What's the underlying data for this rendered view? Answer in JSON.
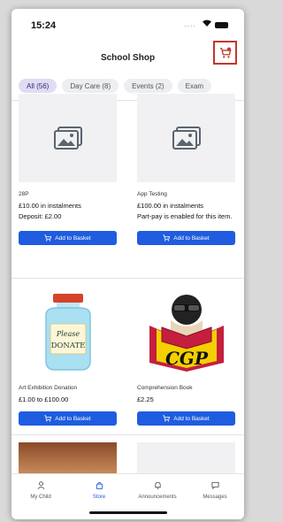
{
  "status_bar": {
    "time": "15:24",
    "dots": "...."
  },
  "header": {
    "title": "School Shop",
    "cart_icon": "shopping-cart-icon",
    "accent": "#c0392b"
  },
  "filters": [
    {
      "label": "All (56)",
      "active": true
    },
    {
      "label": "Day Care (8)",
      "active": false
    },
    {
      "label": "Events (2)",
      "active": false
    },
    {
      "label": "Exam",
      "active": false
    }
  ],
  "products": [
    {
      "name": "28P",
      "price": "£10.00 in instalments",
      "extra": "Deposit: £2.00",
      "image": "image-placeholder-icon"
    },
    {
      "name": "App Testing",
      "price": "£100.00 in instalments",
      "extra": "Part-pay is enabled for this item.",
      "image": "image-placeholder-icon"
    },
    {
      "name": "Art Exhibition Donation",
      "price": "£1.00 to £100.00",
      "extra": "",
      "image": "donation-jar-image",
      "image_text": "Please\nDONATE"
    },
    {
      "name": "Comprehension Book",
      "price": "£2.25",
      "extra": "",
      "image": "cgp-book-image",
      "image_text": "CGP"
    }
  ],
  "add_to_basket_label": "Add to Basket",
  "button_color": "#1f5ce0",
  "tabs": [
    {
      "label": "My Child",
      "icon": "person-icon",
      "active": false
    },
    {
      "label": "Store",
      "icon": "bag-icon",
      "active": true
    },
    {
      "label": "Announcements",
      "icon": "bell-icon",
      "active": false
    },
    {
      "label": "Messages",
      "icon": "chat-icon",
      "active": false
    }
  ]
}
